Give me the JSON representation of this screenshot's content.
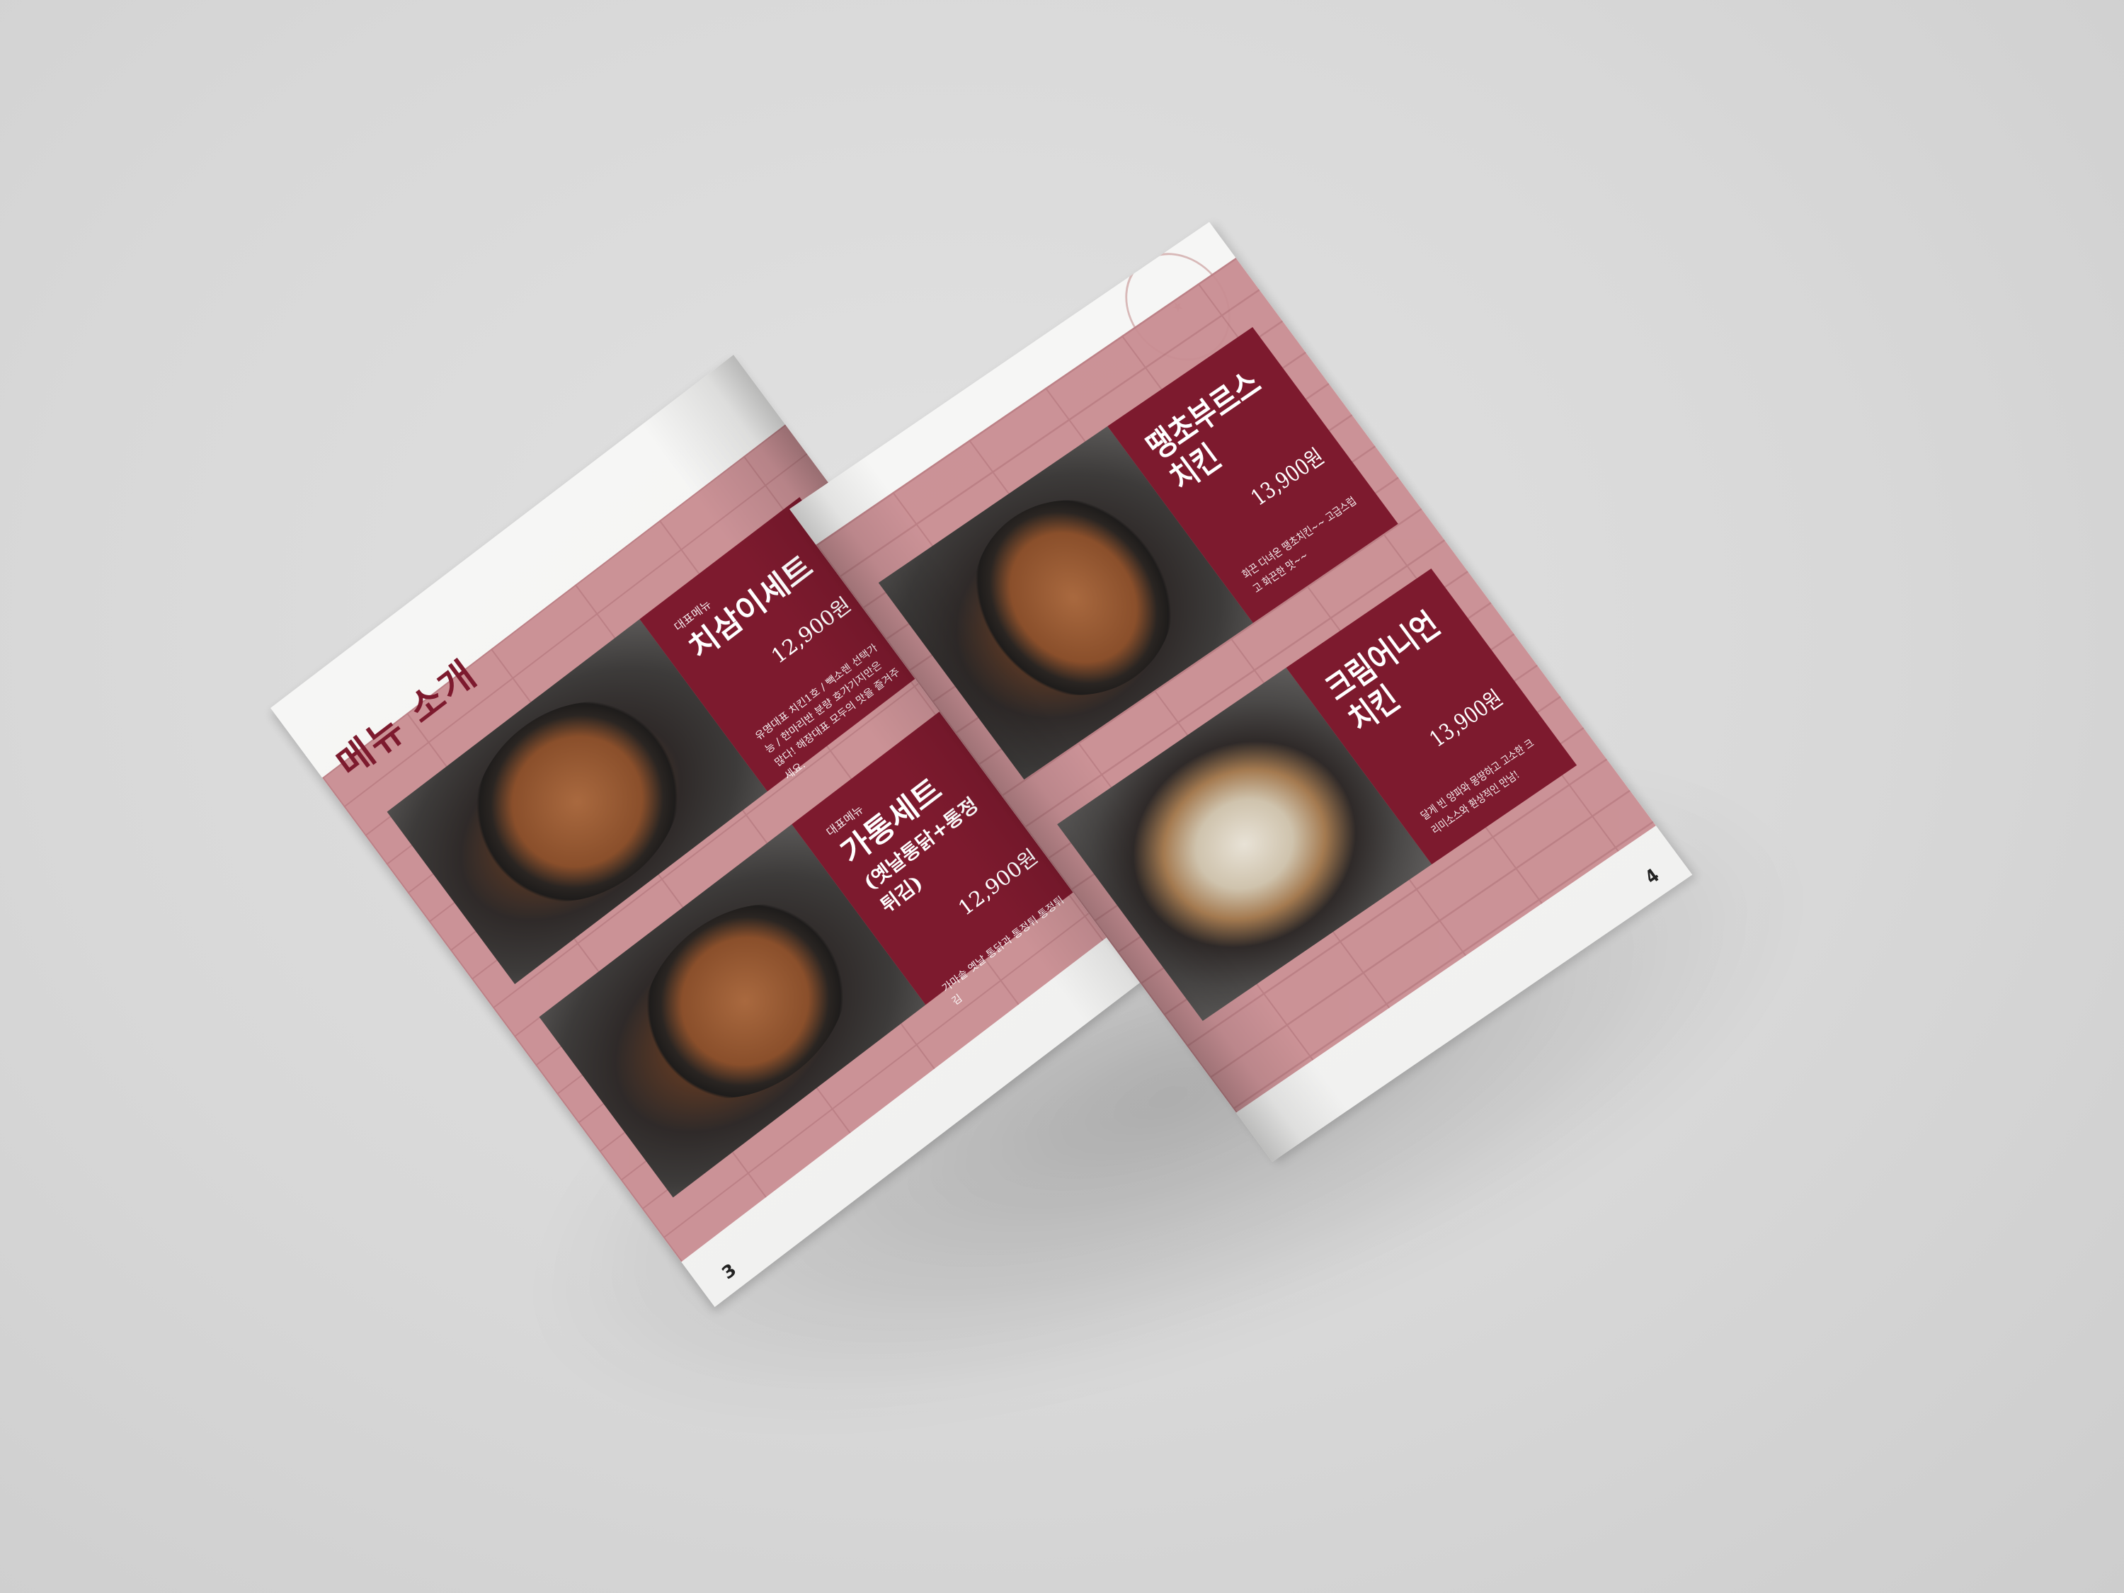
{
  "brochure": {
    "section_title": "메뉴 소개",
    "left_page": {
      "page_number": "3",
      "items": [
        {
          "tag": "대표메뉴",
          "name": "치삼이세트",
          "subtitle": "",
          "price": "12,900원",
          "description": "유명대표 치킨1호 / 빽소렌 선택가능 / 한마리반 분량 호가기지만은 많다! 해장대표 모두의 맛을 즐겨주세요."
        },
        {
          "tag": "대표메뉴",
          "name": "가통세트",
          "subtitle": "(옛날통닭+통정튀김)",
          "price": "12,900원",
          "description": "가마솥 옛날 통닭과 통정튀 통정튀김"
        }
      ]
    },
    "right_page": {
      "page_number": "4",
      "items": [
        {
          "tag": "",
          "name": "땡초부르스치킨",
          "subtitle": "",
          "price": "13,900원",
          "description": "화끈 다녀온 땡초치킨~~ 고급스럽고 화끈한 맛~~"
        },
        {
          "tag": "",
          "name": "크림어니언치킨",
          "subtitle": "",
          "price": "13,900원",
          "description": "달게 빈 양파와 몽땅하고 고소한 크리미소스와 환상적인 만남!"
        }
      ]
    },
    "colors": {
      "accent": "#7d1a2e",
      "brick": "#c98d92",
      "background": "#d9d9d9"
    }
  }
}
